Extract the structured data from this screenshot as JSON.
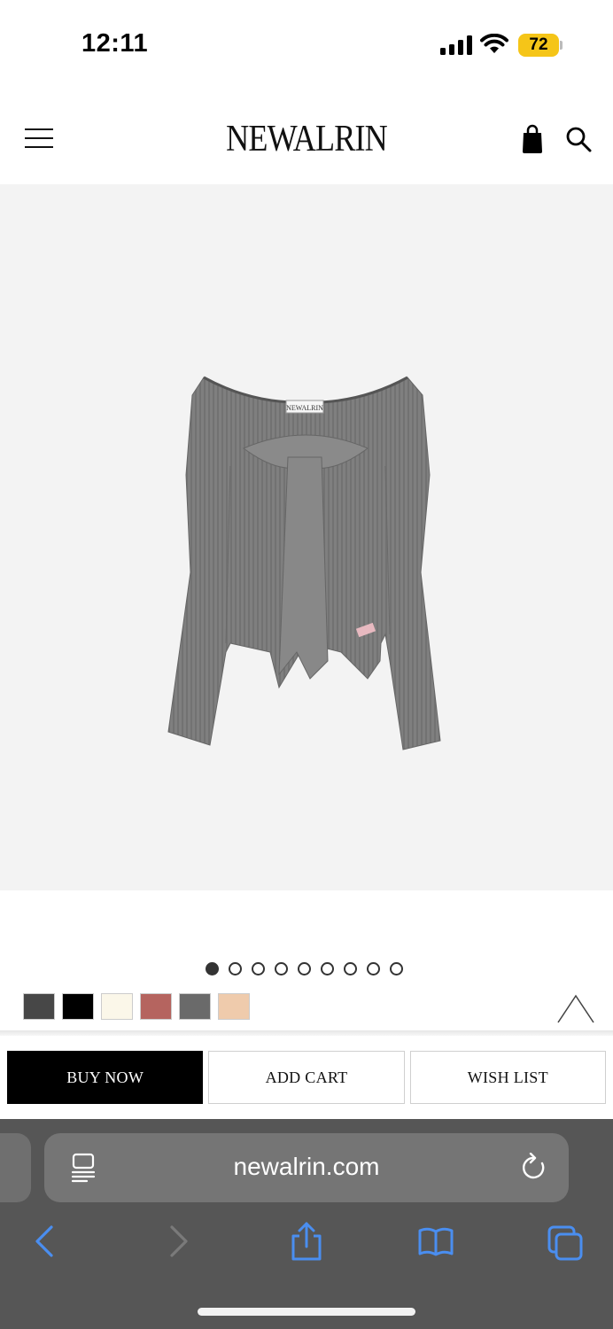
{
  "status_bar": {
    "time": "12:11",
    "battery": "72",
    "battery_color": "#f5c518"
  },
  "header": {
    "logo": "NEWALRIN",
    "menu_icon": "hamburger-menu-icon",
    "cart_icon": "shopping-bag-icon",
    "search_icon": "search-icon"
  },
  "product": {
    "image_description_icon": "product-photo",
    "carousel": {
      "count": 9,
      "active_index": 0
    },
    "swatches": [
      {
        "color": "#474747"
      },
      {
        "color": "#000000"
      },
      {
        "color": "#fbf7e9"
      },
      {
        "color": "#b5645f"
      },
      {
        "color": "#6a6a6a"
      },
      {
        "color": "#efcbac"
      }
    ]
  },
  "actions": {
    "buy_now": "BUY NOW",
    "add_cart": "ADD CART",
    "wish_list": "WISH LIST"
  },
  "browser": {
    "url": "newalrin.com",
    "accent": "#4a8ef0"
  }
}
